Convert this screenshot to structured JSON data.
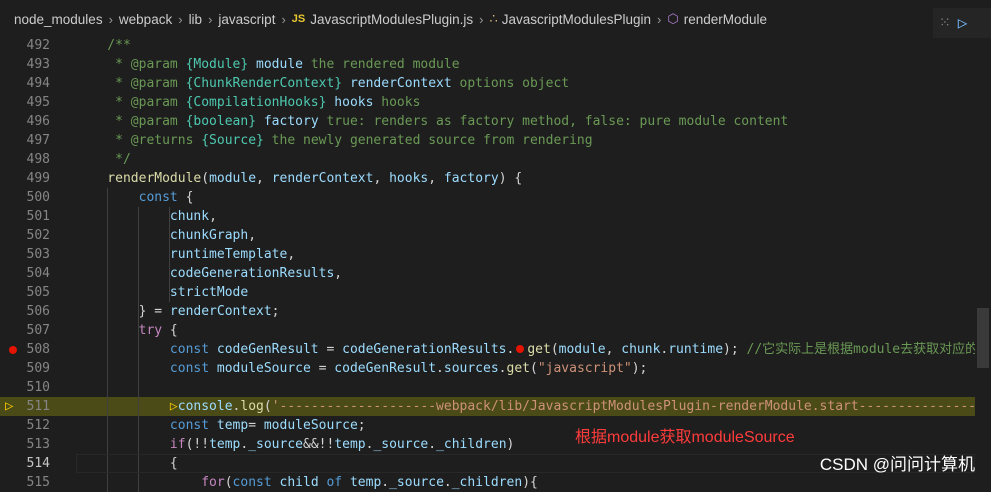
{
  "breadcrumb": {
    "items": [
      "node_modules",
      "webpack",
      "lib",
      "javascript",
      "JavascriptModulesPlugin.js",
      "JavascriptModulesPlugin",
      "renderModule"
    ],
    "js_badge": "JS"
  },
  "annotation": "根据module获取moduleSource",
  "watermark": "CSDN @问问计算机",
  "colors": {
    "breakpoint": "#e51400",
    "debug_arrow": "#ffcc00",
    "highlight_line": "#4b4b18",
    "annotation": "#ff3b3b"
  },
  "lines": [
    {
      "n": "492",
      "toks": [
        [
          "cm",
          "    /**"
        ]
      ]
    },
    {
      "n": "493",
      "toks": [
        [
          "cm",
          "     * @param "
        ],
        [
          "ty",
          "{Module}"
        ],
        [
          "var",
          " module"
        ],
        [
          "cm",
          " the rendered module"
        ]
      ]
    },
    {
      "n": "494",
      "toks": [
        [
          "cm",
          "     * @param "
        ],
        [
          "ty",
          "{ChunkRenderContext}"
        ],
        [
          "var",
          " renderContext"
        ],
        [
          "cm",
          " options object"
        ]
      ]
    },
    {
      "n": "495",
      "toks": [
        [
          "cm",
          "     * @param "
        ],
        [
          "ty",
          "{CompilationHooks}"
        ],
        [
          "var",
          " hooks"
        ],
        [
          "cm",
          " hooks"
        ]
      ]
    },
    {
      "n": "496",
      "toks": [
        [
          "cm",
          "     * @param "
        ],
        [
          "ty",
          "{boolean}"
        ],
        [
          "var",
          " factory"
        ],
        [
          "cm",
          " true: renders as factory method, false: pure module content"
        ]
      ]
    },
    {
      "n": "497",
      "toks": [
        [
          "cm",
          "     * @returns "
        ],
        [
          "ty",
          "{Source}"
        ],
        [
          "cm",
          " the newly generated source from rendering"
        ]
      ]
    },
    {
      "n": "498",
      "toks": [
        [
          "cm",
          "     */"
        ]
      ]
    },
    {
      "n": "499",
      "toks": [
        [
          "fn",
          "    renderModule"
        ],
        [
          "pun",
          "("
        ],
        [
          "var",
          "module"
        ],
        [
          "pun",
          ", "
        ],
        [
          "var",
          "renderContext"
        ],
        [
          "pun",
          ", "
        ],
        [
          "var",
          "hooks"
        ],
        [
          "pun",
          ", "
        ],
        [
          "var",
          "factory"
        ],
        [
          "pun",
          ") {"
        ]
      ]
    },
    {
      "n": "500",
      "toks": [
        [
          "kw",
          "        const"
        ],
        [
          "pun",
          " {"
        ]
      ]
    },
    {
      "n": "501",
      "toks": [
        [
          "var",
          "            chunk"
        ],
        [
          "pun",
          ","
        ]
      ]
    },
    {
      "n": "502",
      "toks": [
        [
          "var",
          "            chunkGraph"
        ],
        [
          "pun",
          ","
        ]
      ]
    },
    {
      "n": "503",
      "toks": [
        [
          "var",
          "            runtimeTemplate"
        ],
        [
          "pun",
          ","
        ]
      ]
    },
    {
      "n": "504",
      "toks": [
        [
          "var",
          "            codeGenerationResults"
        ],
        [
          "pun",
          ","
        ]
      ]
    },
    {
      "n": "505",
      "toks": [
        [
          "var",
          "            strictMode"
        ]
      ]
    },
    {
      "n": "506",
      "toks": [
        [
          "pun",
          "        } = "
        ],
        [
          "var",
          "renderContext"
        ],
        [
          "pun",
          ";"
        ]
      ]
    },
    {
      "n": "507",
      "toks": [
        [
          "kw2",
          "        try"
        ],
        [
          "pun",
          " {"
        ]
      ]
    },
    {
      "n": "508",
      "bp": true,
      "toks": [
        [
          "kw",
          "            const"
        ],
        [
          "var",
          " codeGenResult"
        ],
        [
          "pun",
          " = "
        ],
        [
          "var",
          "codeGenerationResults"
        ],
        [
          "pun",
          "."
        ],
        [
          "bp",
          ""
        ],
        [
          "fn",
          "get"
        ],
        [
          "pun",
          "("
        ],
        [
          "var",
          "module"
        ],
        [
          "pun",
          ", "
        ],
        [
          "var",
          "chunk"
        ],
        [
          "pun",
          "."
        ],
        [
          "var",
          "runtime"
        ],
        [
          "pun",
          "); "
        ],
        [
          "cm",
          "//它实际上是根据module去获取对应的"
        ]
      ]
    },
    {
      "n": "509",
      "toks": [
        [
          "kw",
          "            const"
        ],
        [
          "var",
          " moduleSource"
        ],
        [
          "pun",
          " = "
        ],
        [
          "var",
          "codeGenResult"
        ],
        [
          "pun",
          "."
        ],
        [
          "var",
          "sources"
        ],
        [
          "pun",
          "."
        ],
        [
          "fn",
          "get"
        ],
        [
          "pun",
          "("
        ],
        [
          "str",
          "\"javascript\""
        ],
        [
          "pun",
          ");"
        ]
      ]
    },
    {
      "n": "510",
      "toks": []
    },
    {
      "n": "511",
      "hl": true,
      "arrow": true,
      "toks": [
        [
          "pun",
          "            "
        ],
        [
          "arrow",
          ""
        ],
        [
          "var",
          "console"
        ],
        [
          "pun",
          "."
        ],
        [
          "fn",
          "log"
        ],
        [
          "pun",
          "("
        ],
        [
          "str",
          "'--------------------webpack/lib/JavascriptModulesPlugin-renderModule.start-------------------"
        ]
      ]
    },
    {
      "n": "512",
      "toks": [
        [
          "kw",
          "            const"
        ],
        [
          "var",
          " temp"
        ],
        [
          "pun",
          "= "
        ],
        [
          "var",
          "moduleSource"
        ],
        [
          "pun",
          ";"
        ]
      ]
    },
    {
      "n": "513",
      "toks": [
        [
          "kw2",
          "            if"
        ],
        [
          "pun",
          "(!!"
        ],
        [
          "var",
          "temp"
        ],
        [
          "pun",
          "."
        ],
        [
          "var",
          "_source"
        ],
        [
          "pun",
          "&&!!"
        ],
        [
          "var",
          "temp"
        ],
        [
          "pun",
          "."
        ],
        [
          "var",
          "_source"
        ],
        [
          "pun",
          "."
        ],
        [
          "var",
          "_children"
        ],
        [
          "pun",
          ")"
        ]
      ]
    },
    {
      "n": "514",
      "cur": true,
      "toks": [
        [
          "pun",
          "            {"
        ]
      ]
    },
    {
      "n": "515",
      "toks": [
        [
          "kw2",
          "                for"
        ],
        [
          "pun",
          "("
        ],
        [
          "kw",
          "const"
        ],
        [
          "var",
          " child"
        ],
        [
          "kw",
          " of"
        ],
        [
          "var",
          " temp"
        ],
        [
          "pun",
          "."
        ],
        [
          "var",
          "_source"
        ],
        [
          "pun",
          "."
        ],
        [
          "var",
          "_children"
        ],
        [
          "pun",
          "){"
        ]
      ]
    }
  ]
}
